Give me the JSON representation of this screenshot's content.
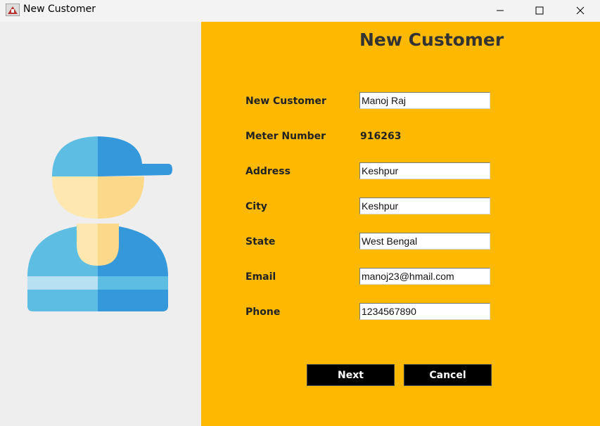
{
  "window": {
    "title": "New Customer"
  },
  "form": {
    "heading": "New Customer",
    "fields": [
      {
        "label": "New Customer",
        "value": "Manoj Raj"
      },
      {
        "label": "Meter Number",
        "value": "916263"
      },
      {
        "label": "Address",
        "value": "Keshpur"
      },
      {
        "label": "City",
        "value": "Keshpur"
      },
      {
        "label": "State",
        "value": "West Bengal"
      },
      {
        "label": "Email",
        "value": "manoj23@hmail.com"
      },
      {
        "label": "Phone",
        "value": "1234567890"
      }
    ],
    "buttons": {
      "next": "Next",
      "cancel": "Cancel"
    }
  },
  "colors": {
    "panel": "#fdb900",
    "cap_light": "#5dbde2",
    "cap_dark": "#3498db",
    "skin_light": "#ffe8b0",
    "skin_dark": "#fcd88a"
  },
  "icons": {
    "app": "app-icon",
    "minimize": "minimize-icon",
    "maximize": "maximize-icon",
    "close": "close-icon",
    "illustration": "customer-illustration"
  }
}
